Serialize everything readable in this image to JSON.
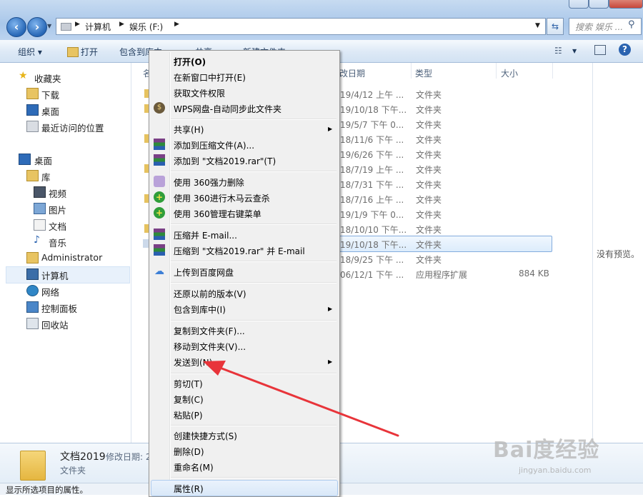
{
  "address": {
    "segments": [
      "计算机",
      "娱乐 (F:)"
    ],
    "search_placeholder": "搜索 娱乐 ..."
  },
  "toolbar": {
    "organize": "组织 ▾",
    "open": "打开",
    "include_in_library": "包含到库中 ▾",
    "share": "共享 ▾",
    "new_folder": "新建文件夹"
  },
  "nav": {
    "favorites": "收藏夹",
    "downloads": "下载",
    "desktop1": "桌面",
    "recent": "最近访问的位置",
    "desktop2": "桌面",
    "library": "库",
    "videos": "视频",
    "pictures": "图片",
    "documents": "文档",
    "music": "音乐",
    "administrator": "Administrator",
    "computer": "计算机",
    "network": "网络",
    "control_panel": "控制面板",
    "recycle_bin": "回收站"
  },
  "columns": {
    "name": "名",
    "date": "改日期",
    "type": "类型",
    "size": "大小"
  },
  "rows": [
    {
      "date": "19/4/12 上午 ...",
      "type": "文件夹",
      "size": ""
    },
    {
      "date": "19/10/18 下午...",
      "type": "文件夹",
      "size": ""
    },
    {
      "date": "19/5/7 下午 0...",
      "type": "文件夹",
      "size": ""
    },
    {
      "date": "18/11/6 下午 ...",
      "type": "文件夹",
      "size": ""
    },
    {
      "date": "19/6/26 下午 ...",
      "type": "文件夹",
      "size": ""
    },
    {
      "date": "18/7/19 上午 ...",
      "type": "文件夹",
      "size": ""
    },
    {
      "date": "18/7/31 下午 ...",
      "type": "文件夹",
      "size": ""
    },
    {
      "date": "18/7/16 上午 ...",
      "type": "文件夹",
      "size": ""
    },
    {
      "date": "19/1/9 下午 0...",
      "type": "文件夹",
      "size": ""
    },
    {
      "date": "18/10/10 下午...",
      "type": "文件夹",
      "size": ""
    },
    {
      "date": "19/10/18 下午...",
      "type": "文件夹",
      "size": ""
    },
    {
      "date": "18/9/25 下午 ...",
      "type": "文件夹",
      "size": ""
    },
    {
      "date": "06/12/1 下午 ...",
      "type": "应用程序扩展",
      "size": "884 KB"
    }
  ],
  "preview": "没有预览。",
  "details": {
    "name": "文档2019",
    "modified_label": "修改日期: 2",
    "type": "文件夹"
  },
  "status": "显示所选项目的属性。",
  "menu": {
    "open": "打开(O)",
    "open_new_window": "在新窗口中打开(E)",
    "get_permission": "获取文件权限",
    "wps_sync": "WPS网盘-自动同步此文件夹",
    "share": "共享(H)",
    "add_archive": "添加到压缩文件(A)...",
    "add_rar": "添加到 \"文档2019.rar\"(T)",
    "del_360": "使用 360强力删除",
    "scan_360": "使用 360进行木马云查杀",
    "manage_360": "使用 360管理右键菜单",
    "compress_email": "压缩并 E-mail...",
    "compress_rar_email": "压缩到 \"文档2019.rar\" 并 E-mail",
    "baidu_upload": "上传到百度网盘",
    "restore": "还原以前的版本(V)",
    "include_library": "包含到库中(I)",
    "copy_to": "复制到文件夹(F)...",
    "move_to": "移动到文件夹(V)...",
    "send_to": "发送到(N)",
    "cut": "剪切(T)",
    "copy": "复制(C)",
    "paste": "粘贴(P)",
    "create_shortcut": "创建快捷方式(S)",
    "delete": "删除(D)",
    "rename": "重命名(M)",
    "properties": "属性(R)"
  },
  "watermark": {
    "logo": "Bai度经验",
    "url": "jingyan.baidu.com"
  },
  "colors": {
    "accent": "#2767b6",
    "selection": "#dcecfc",
    "arrow": "#e8343a"
  }
}
